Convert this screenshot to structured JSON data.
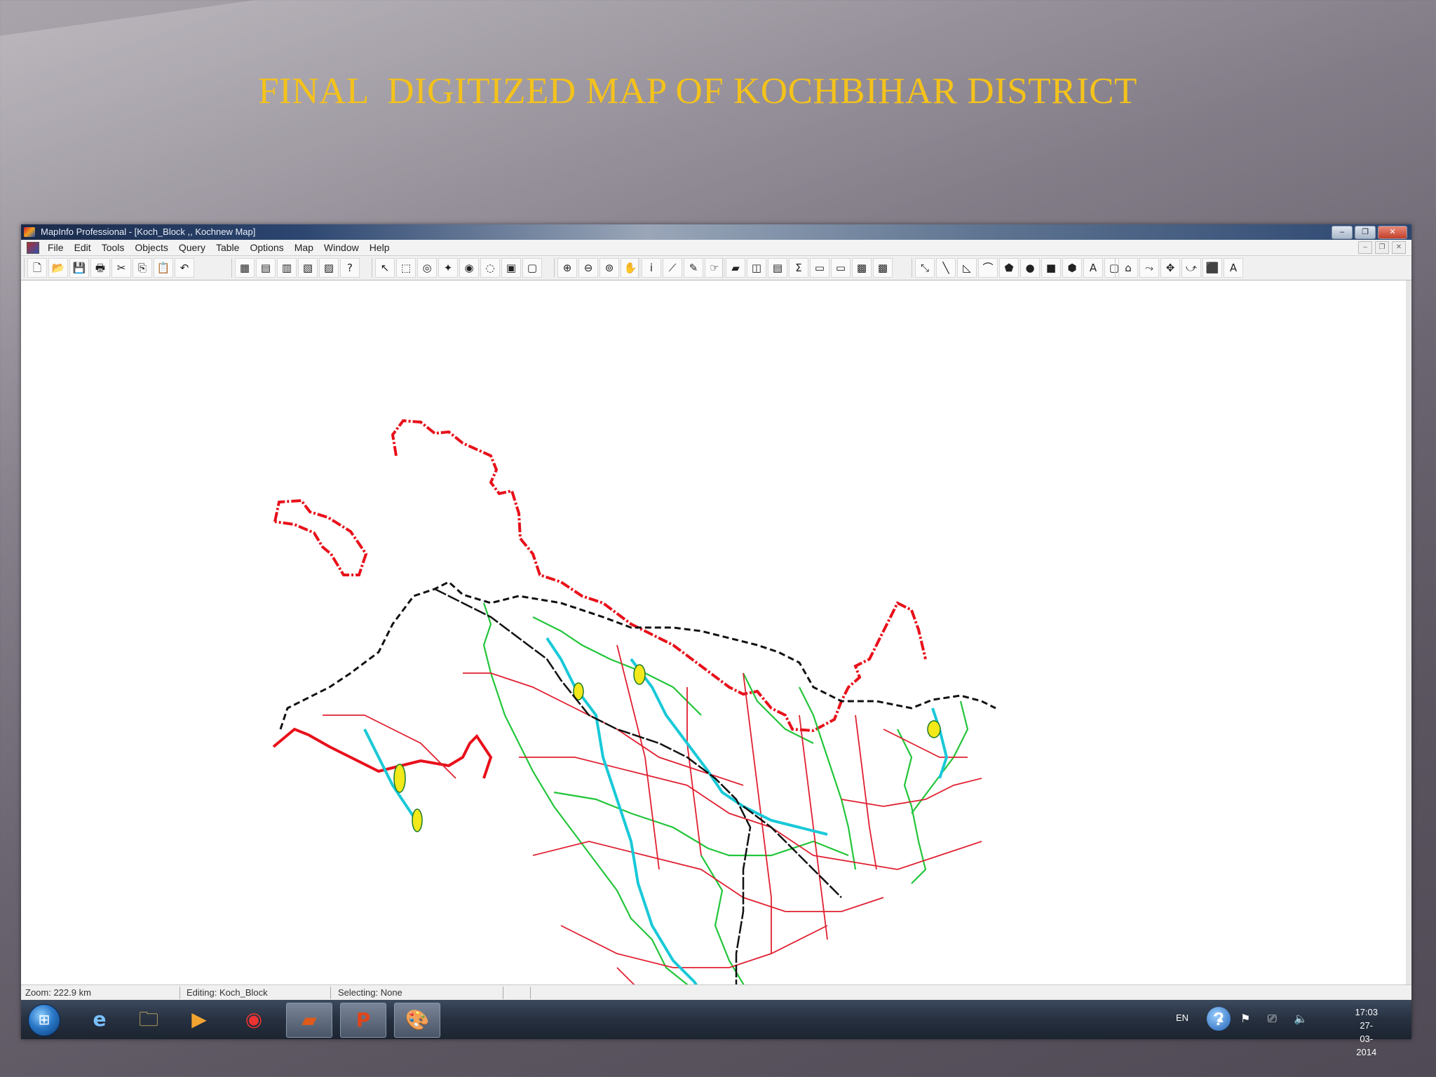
{
  "slide": {
    "title": "FINAL  DIGITIZED MAP OF KOCHBIHAR DISTRICT"
  },
  "window": {
    "title": "MapInfo Professional - [Koch_Block ,, Kochnew Map]",
    "controls": [
      "–",
      "❐",
      "✕"
    ]
  },
  "menu": {
    "items": [
      "File",
      "Edit",
      "Tools",
      "Objects",
      "Query",
      "Table",
      "Options",
      "Map",
      "Window",
      "Help"
    ],
    "mdi_controls": [
      "–",
      "❐",
      "✕"
    ]
  },
  "toolbar": {
    "groups": [
      [
        "🗋",
        "📂",
        "💾",
        "🖶",
        "✂",
        "⎘",
        "📋",
        "↶"
      ],
      [
        "▦",
        "▤",
        "▥",
        "▧",
        "▨",
        "?"
      ],
      [
        "↖",
        "⬚",
        "◎",
        "✦",
        "◉",
        "◌",
        "▣",
        "▢"
      ],
      [
        "⊕",
        "⊖",
        "⊚",
        "✋"
      ],
      [
        "i",
        "⟋",
        "✎",
        "☞"
      ],
      [
        "▰",
        "◫",
        "▤",
        "Σ",
        "▭",
        "▭",
        "▩",
        "▩"
      ],
      [
        "⤡",
        "╲",
        "◺",
        "⌒",
        "⬟",
        "●",
        "■",
        "⬢",
        "A",
        "▢"
      ],
      [
        "⌂",
        "⤳",
        "✥",
        "⤻",
        "⬛",
        "A"
      ]
    ]
  },
  "status": {
    "zoom": "Zoom: 222.9 km",
    "editing": "Editing: Koch_Block",
    "selecting": "Selecting: None"
  },
  "taskbar": {
    "apps": [
      "ie-browser",
      "file-explorer",
      "media-player",
      "chrome",
      "mapinfo",
      "powerpoint",
      "paint"
    ],
    "app_glyphs": [
      "e",
      "🗀",
      "▶",
      "◉",
      "▰",
      "P",
      "🎨"
    ],
    "language": "EN",
    "help_glyph": "?",
    "tray_glyphs": "▴ ⚑ ⎚ 🔈",
    "time": "17:03",
    "date": "27-03-2014"
  },
  "colors": {
    "title": "#f4c21b",
    "boundary": "#e8101a",
    "roads": "#e02030",
    "river_green": "#22c53a",
    "river_cyan": "#19c9d8",
    "rail": "#111111",
    "water_body": "#f2e81a"
  }
}
